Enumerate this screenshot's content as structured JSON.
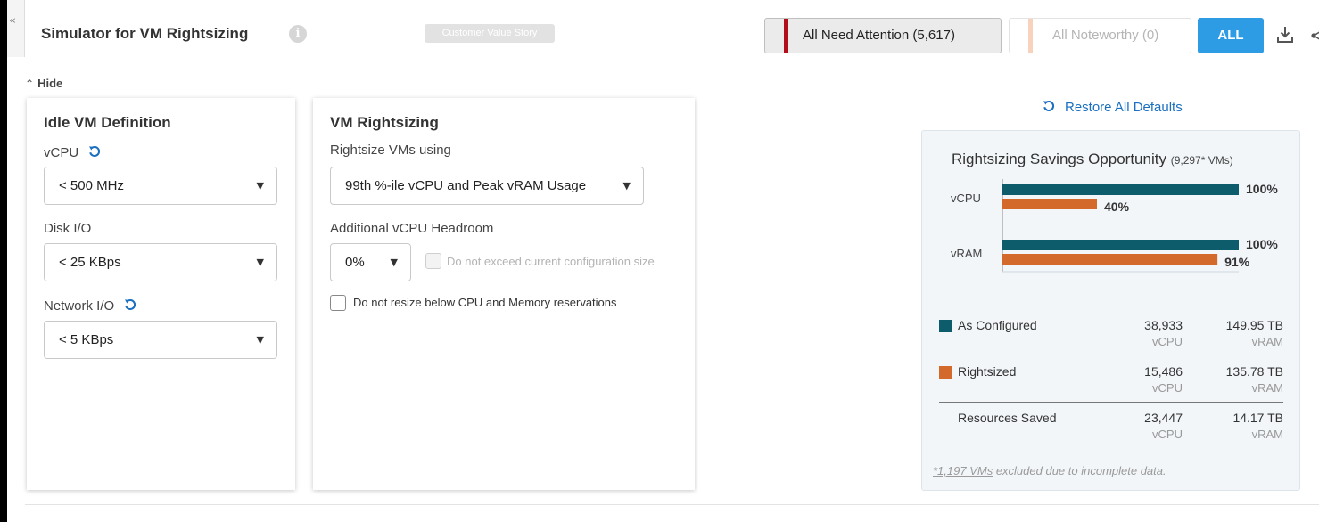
{
  "header": {
    "collapse_glyph": "«",
    "title": "Simulator for VM Rightsizing",
    "info_glyph": "i",
    "customer_value_story": "Customer Value Story",
    "filters": {
      "attention": "All Need Attention (5,617)",
      "noteworthy": "All Noteworthy (0)",
      "all": "ALL"
    },
    "icons": [
      "info-icon",
      "download-icon",
      "share-icon"
    ]
  },
  "toggle": {
    "chevron": "⌃",
    "label": "Hide"
  },
  "idle_vm": {
    "title": "Idle VM Definition",
    "vcpu_label": "vCPU",
    "vcpu_value": "< 500 MHz",
    "disk_label": "Disk I/O",
    "disk_value": "< 25 KBps",
    "network_label": "Network I/O",
    "network_value": "< 5 KBps"
  },
  "rightsizing": {
    "title": "VM Rightsizing",
    "using_label": "Rightsize VMs using",
    "using_value": "99th %-ile vCPU and Peak vRAM Usage",
    "headroom_label": "Additional vCPU Headroom",
    "headroom_value": "0%",
    "no_exceed_label": "Do not exceed current configuration size",
    "no_exceed_checked": false,
    "no_exceed_disabled": true,
    "no_resize_label": "Do not resize below CPU and Memory reservations",
    "no_resize_checked": false
  },
  "restore": {
    "label": "Restore All Defaults"
  },
  "savings": {
    "title": "Rightsizing Savings Opportunity",
    "subtitle": "(9,297* VMs)",
    "rows": [
      {
        "label": "As Configured",
        "vcpu": "38,933",
        "vcpu_unit": "vCPU",
        "vram": "149.95 TB",
        "vram_unit": "vRAM"
      },
      {
        "label": "Rightsized",
        "vcpu": "15,486",
        "vcpu_unit": "vCPU",
        "vram": "135.78 TB",
        "vram_unit": "vRAM"
      },
      {
        "label": "Resources Saved",
        "vcpu": "23,447",
        "vcpu_unit": "vCPU",
        "vram": "14.17 TB",
        "vram_unit": "vRAM"
      }
    ],
    "footnote_link": "*1,197 VMs",
    "footnote_text": " excluded due to incomplete data."
  },
  "chart_data": {
    "type": "bar",
    "categories": [
      "vCPU",
      "vRAM"
    ],
    "series": [
      {
        "name": "As Configured",
        "values": [
          100,
          100
        ],
        "labels": [
          "100%",
          "100%"
        ],
        "color": "#0d5c6b"
      },
      {
        "name": "Rightsized",
        "values": [
          40,
          91
        ],
        "labels": [
          "40%",
          "91%"
        ],
        "color": "#d4692c"
      }
    ],
    "xlim": [
      0,
      100
    ],
    "orientation": "horizontal"
  },
  "colors": {
    "accent": "#2e9be5",
    "critical": "#b10d1b",
    "noteworthy": "#f8d2bd",
    "link": "#1a6fc1",
    "as_configured": "#0d5c6b",
    "rightsized": "#d4692c"
  }
}
